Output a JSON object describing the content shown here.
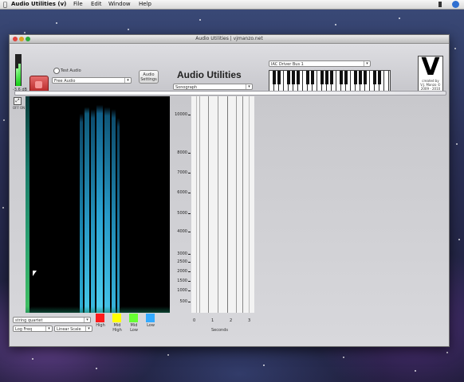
{
  "menubar": {
    "app_name": "Audio Utilities (v)",
    "menus": [
      "File",
      "Edit",
      "Window",
      "Help"
    ]
  },
  "window": {
    "title": "Audio Utilities | vjmanzo.net"
  },
  "header": {
    "meter_label": "-3.6 dB",
    "test_audio_label": "Test Audio",
    "source_select_value": "Free Audio",
    "audio_settings_label": "Audio Settings",
    "app_title": "Audio Utilities",
    "mode_select_value": "Sonograph",
    "midi_select_value": "IAC Driver Bus 1",
    "logo_text": "created by V.J. Manzo © 2009 - 2010"
  },
  "spectrogram": {
    "side_label": "OFF ON"
  },
  "fft_panel": {
    "y_ticks": [
      "10000",
      "8000",
      "7000",
      "6000",
      "5000",
      "4000",
      "3000",
      "2500",
      "2000",
      "1500",
      "1000",
      "500"
    ],
    "x_ticks": [
      "0",
      "1",
      "2",
      "3"
    ],
    "x_label": "Seconds"
  },
  "controls": {
    "preset_select_value": "string quartet",
    "scale_select_value": "Log Freq",
    "scale2_select_value": "Linear Scale",
    "legend": [
      {
        "label": "High",
        "color": "#ff1a1a"
      },
      {
        "label": "Mid High",
        "color": "#ffff00"
      },
      {
        "label": "Mid Low",
        "color": "#66ff33"
      },
      {
        "label": "Low",
        "color": "#33aaff"
      }
    ]
  }
}
